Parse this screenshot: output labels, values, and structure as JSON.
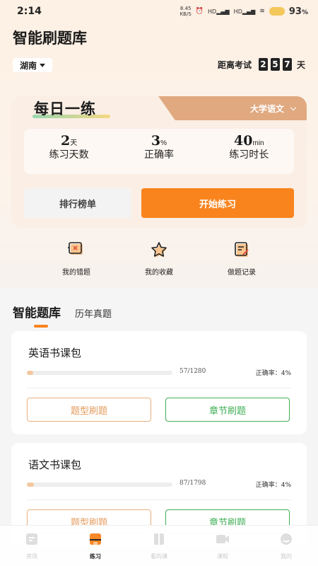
{
  "status_bar": {
    "time": "2:14",
    "net_speed": "8.45",
    "net_unit": "KB/S",
    "signal1": "HD",
    "signal2": "HD",
    "battery_value": "93",
    "battery_unit": "%"
  },
  "header": {
    "title": "智能刷题库",
    "region": "湖南",
    "countdown_label": "距离考试",
    "countdown_digits": [
      "2",
      "5",
      "7"
    ],
    "countdown_unit": "天"
  },
  "daily": {
    "title": "每日一练",
    "subject": "大学语文",
    "stats": [
      {
        "value": "2",
        "unit": "天",
        "label": "练习天数"
      },
      {
        "value": "3",
        "unit": "%",
        "label": "正确率"
      },
      {
        "value": "40",
        "unit": "min",
        "label": "练习时长"
      }
    ],
    "rank_button": "排行榜单",
    "start_button": "开始练习"
  },
  "shortcuts": [
    {
      "label": "我的错题",
      "icon": "wrong-questions-icon"
    },
    {
      "label": "我的收藏",
      "icon": "star-icon"
    },
    {
      "label": "做题记录",
      "icon": "record-icon"
    }
  ],
  "tabs": {
    "active": "智能题库",
    "inactive": "历年真题"
  },
  "packages": [
    {
      "title": "英语书课包",
      "count": "57/1280",
      "progress": 0.045,
      "accuracy": "正确率：4%",
      "btn_type": "题型刷题",
      "btn_chapter": "章节刷题"
    },
    {
      "title": "语文书课包",
      "count": "87/1798",
      "progress": 0.048,
      "accuracy": "正确率：4%",
      "btn_type": "题型刷题",
      "btn_chapter": "章节刷题"
    }
  ],
  "nav": [
    {
      "label": "资讯",
      "icon": "news-icon",
      "active": false
    },
    {
      "label": "练习",
      "icon": "practice-icon",
      "active": true
    },
    {
      "label": "看的课",
      "icon": "book-icon",
      "active": false
    },
    {
      "label": "课程",
      "icon": "video-icon",
      "active": false
    },
    {
      "label": "我的",
      "icon": "profile-icon",
      "active": false
    }
  ],
  "colors": {
    "accent": "#f9841e",
    "tab_brown": "#e0a980",
    "green": "#3fae55"
  }
}
